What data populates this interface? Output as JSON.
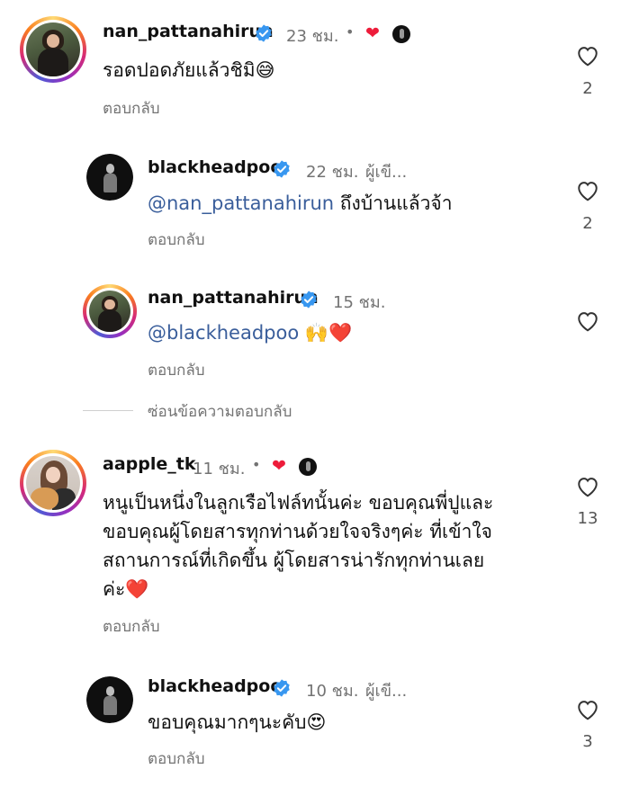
{
  "comments": [
    {
      "username": "nan_pattanahirun",
      "time": "23 ชม.",
      "text": "รอดปอดภัยแล้วชิมิ",
      "emoji": "😅",
      "reply_label": "ตอบกลับ",
      "likes": "2"
    },
    {
      "username": "blackheadpoo",
      "time": "22 ชม.",
      "author_tag": "ผู้เขี...",
      "mention": "@nan_pattanahirun",
      "text": " ถึงบ้านแล้วจ้า",
      "reply_label": "ตอบกลับ",
      "likes": "2"
    },
    {
      "username": "nan_pattanahirun",
      "time": "15 ชม.",
      "mention": "@blackheadpoo",
      "emoji": " 🙌❤️",
      "reply_label": "ตอบกลับ"
    },
    {
      "username": "aapple_tk",
      "time": "11 ชม.",
      "lines": [
        "หนูเป็นหนึ่งในลูกเรือไฟล์ทนั้นค่ะ ขอบคุณพี่ปูและ",
        "ขอบคุณผู้โดยสารทุกท่านด้วยใจจริงๆค่ะ ที่เข้าใจ",
        "สถานการณ์ที่เกิดขึ้น ผู้โดยสารน่ารักทุกท่านเลย",
        "ค่ะ"
      ],
      "emoji": "❤️",
      "reply_label": "ตอบกลับ",
      "likes": "13"
    },
    {
      "username": "blackheadpoo",
      "time": "10 ชม.",
      "author_tag": "ผู้เขี...",
      "text": "ขอบคุณมากๆนะคับ",
      "emoji": "😍",
      "reply_label": "ตอบกลับ",
      "likes": "3"
    }
  ],
  "hide_replies_label": "ซ่อนข้อความตอบกลับ",
  "separator_dot": "•",
  "icons": {
    "verified": "verified-badge-icon",
    "like": "heart-outline-icon",
    "creator_liked": "red-heart-icon"
  },
  "colors": {
    "verified": "#3897f0",
    "mention": "#3a5e9b",
    "heart": "#ed1c3a",
    "secondary_text": "#737373"
  }
}
